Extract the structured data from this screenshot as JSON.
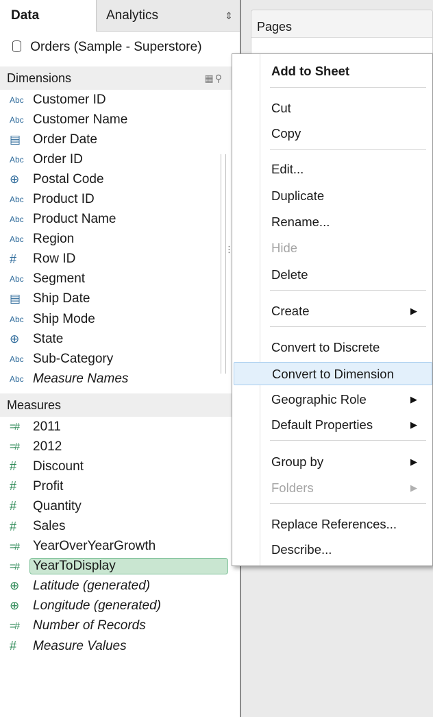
{
  "tabs": {
    "data": "Data",
    "analytics": "Analytics"
  },
  "datasource": "Orders (Sample - Superstore)",
  "dimensions": {
    "title": "Dimensions",
    "fields": [
      {
        "type": "Abc",
        "name": "Customer ID"
      },
      {
        "type": "Abc",
        "name": "Customer Name"
      },
      {
        "type": "calendar",
        "name": "Order Date"
      },
      {
        "type": "Abc",
        "name": "Order ID"
      },
      {
        "type": "globe",
        "name": "Postal Code"
      },
      {
        "type": "Abc",
        "name": "Product ID"
      },
      {
        "type": "Abc",
        "name": "Product Name"
      },
      {
        "type": "Abc",
        "name": "Region"
      },
      {
        "type": "#",
        "name": "Row ID"
      },
      {
        "type": "Abc",
        "name": "Segment"
      },
      {
        "type": "calendar",
        "name": "Ship Date"
      },
      {
        "type": "Abc",
        "name": "Ship Mode"
      },
      {
        "type": "globe",
        "name": "State"
      },
      {
        "type": "Abc",
        "name": "Sub-Category"
      },
      {
        "type": "Abc",
        "name": "Measure Names"
      }
    ]
  },
  "measures": {
    "title": "Measures",
    "fields": [
      {
        "type": "=#",
        "name": "2011"
      },
      {
        "type": "=#",
        "name": "2012"
      },
      {
        "type": "#",
        "name": "Discount"
      },
      {
        "type": "#",
        "name": "Profit"
      },
      {
        "type": "#",
        "name": "Quantity"
      },
      {
        "type": "#",
        "name": "Sales"
      },
      {
        "type": "=#",
        "name": "YearOverYearGrowth"
      },
      {
        "type": "=#",
        "name": "YearToDisplay"
      },
      {
        "type": "globe",
        "name": "Latitude (generated)"
      },
      {
        "type": "globe",
        "name": "Longitude (generated)"
      },
      {
        "type": "=#",
        "name": "Number of Records"
      },
      {
        "type": "#",
        "name": "Measure Values"
      }
    ]
  },
  "pages_title": "Pages",
  "menu": {
    "add_to_sheet": "Add to Sheet",
    "cut": "Cut",
    "copy": "Copy",
    "edit": "Edit...",
    "duplicate": "Duplicate",
    "rename": "Rename...",
    "hide": "Hide",
    "delete": "Delete",
    "create": "Create",
    "convert_discrete": "Convert to Discrete",
    "convert_dimension": "Convert to Dimension",
    "geographic_role": "Geographic Role",
    "default_properties": "Default Properties",
    "group_by": "Group by",
    "folders": "Folders",
    "replace_references": "Replace References...",
    "describe": "Describe..."
  },
  "colors": {
    "selected_field_bg": "#c9e6d1",
    "menu_hover_bg": "#e3f0fb",
    "dimension_icon": "#2f6b9b",
    "measure_icon": "#2e8a57"
  }
}
